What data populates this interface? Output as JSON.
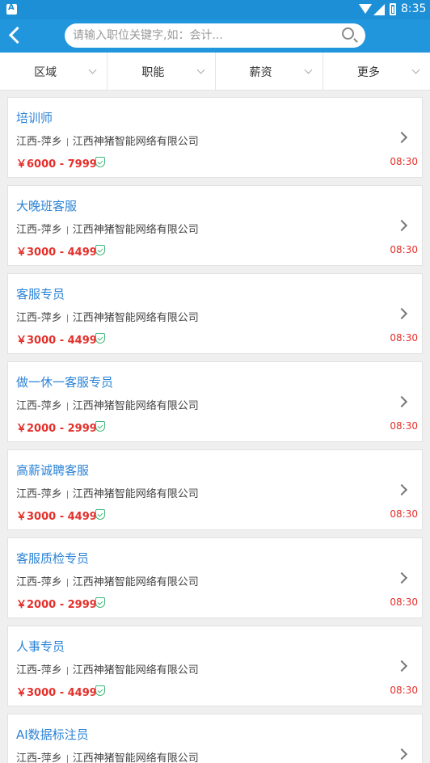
{
  "statusbar": {
    "time": "8:35"
  },
  "navbar": {
    "search_placeholder": "请输入职位关键字,如：会计..."
  },
  "filters": [
    {
      "label": "区域"
    },
    {
      "label": "职能"
    },
    {
      "label": "薪资"
    },
    {
      "label": "更多"
    }
  ],
  "jobs": [
    {
      "title": "培训师",
      "location": "江西-萍乡",
      "company": "江西神猪智能网络有限公司",
      "salary": "￥6000 - 7999",
      "time": "08:30"
    },
    {
      "title": "大晚班客服",
      "location": "江西-萍乡",
      "company": "江西神猪智能网络有限公司",
      "salary": "￥3000 - 4499",
      "time": "08:30"
    },
    {
      "title": "客服专员",
      "location": "江西-萍乡",
      "company": "江西神猪智能网络有限公司",
      "salary": "￥3000 - 4499",
      "time": "08:30"
    },
    {
      "title": "做一休一客服专员",
      "location": "江西-萍乡",
      "company": "江西神猪智能网络有限公司",
      "salary": "￥2000 - 2999",
      "time": "08:30"
    },
    {
      "title": "高薪诚聘客服",
      "location": "江西-萍乡",
      "company": "江西神猪智能网络有限公司",
      "salary": "￥3000 - 4499",
      "time": "08:30"
    },
    {
      "title": "客服质检专员",
      "location": "江西-萍乡",
      "company": "江西神猪智能网络有限公司",
      "salary": "￥2000 - 2999",
      "time": "08:30"
    },
    {
      "title": "人事专员",
      "location": "江西-萍乡",
      "company": "江西神猪智能网络有限公司",
      "salary": "￥3000 - 4499",
      "time": "08:30"
    },
    {
      "title": "AI数据标注员",
      "location": "江西-萍乡",
      "company": "江西神猪智能网络有限公司",
      "salary": "",
      "time": ""
    }
  ]
}
